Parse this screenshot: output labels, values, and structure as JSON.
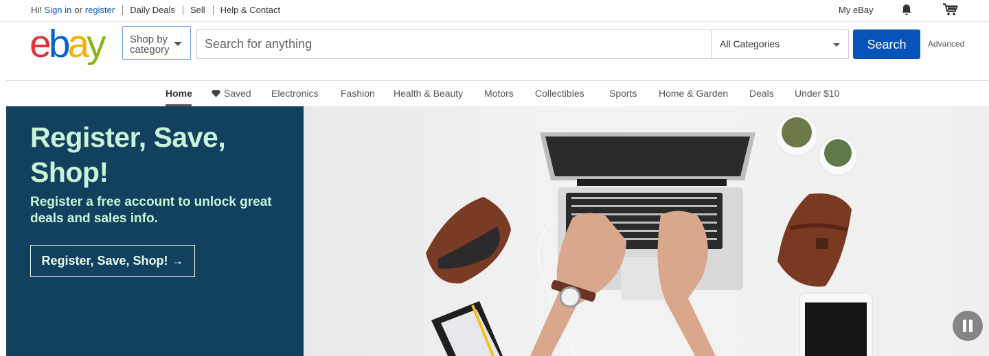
{
  "topbar": {
    "greeting": "Hi!",
    "sign_in": "Sign in",
    "or": "or",
    "register": "register",
    "daily_deals": "Daily Deals",
    "sell": "Sell",
    "help_contact": "Help & Contact",
    "my_ebay": "My eBay",
    "icons": [
      "bell-icon",
      "cart-icon"
    ]
  },
  "header": {
    "logo_letters": [
      "e",
      "b",
      "a",
      "y"
    ],
    "shop_by_line1": "Shop by",
    "shop_by_line2": "category",
    "search_placeholder": "Search for anything",
    "category_selected": "All Categories",
    "search_button": "Search",
    "advanced": "Advanced"
  },
  "nav": {
    "items": [
      "Home",
      "Saved",
      "Electronics",
      "Fashion",
      "Health & Beauty",
      "Motors",
      "Collectibles",
      "Sports",
      "Home & Garden",
      "Deals",
      "Under $10"
    ],
    "active": "Home"
  },
  "hero": {
    "title": "Register, Save, Shop!",
    "subtitle": "Register a free account to unlock great deals and sales info.",
    "cta": "Register, Save, Shop! →"
  },
  "colors": {
    "brand_blue": "#0654ba",
    "promo_bg": "#12405f",
    "promo_text": "#c8f5d6",
    "logo_red": "#e53238",
    "logo_blue": "#0064d2",
    "logo_yellow": "#f5af02",
    "logo_green": "#86b817"
  }
}
